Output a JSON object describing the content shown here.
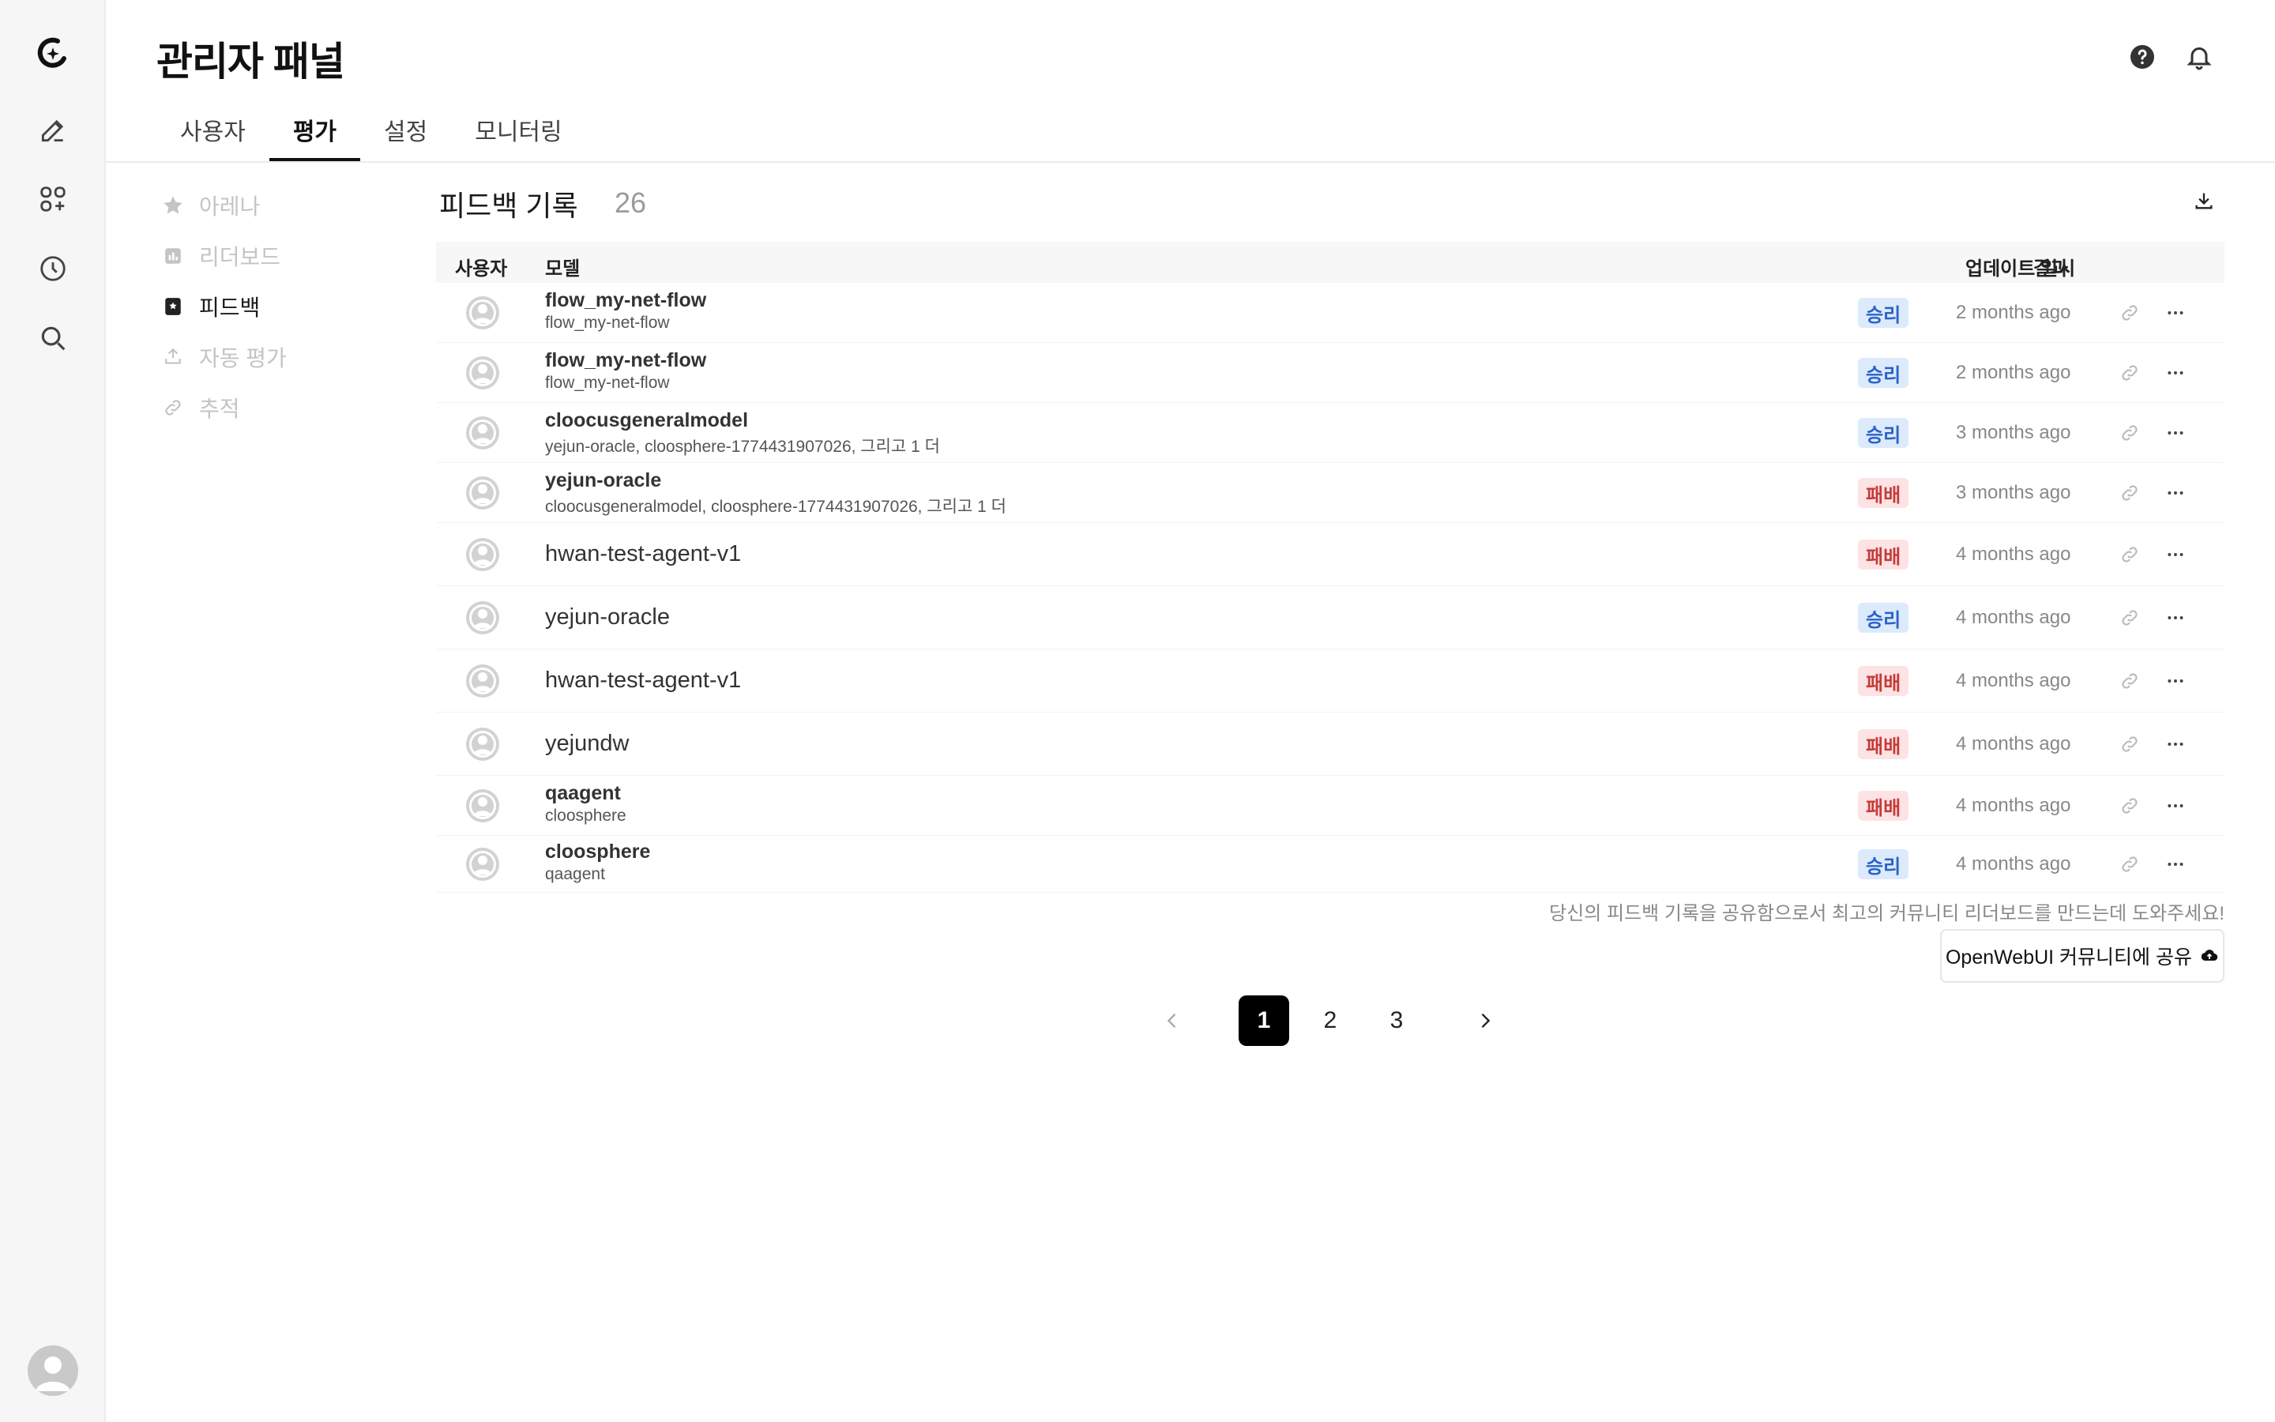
{
  "header": {
    "title": "관리자 패널",
    "tabs": [
      "사용자",
      "평가",
      "설정",
      "모니터링"
    ],
    "active_tab": "평가"
  },
  "rail": {
    "icons": [
      "logo-icon",
      "edit-icon",
      "apps-icon",
      "history-icon",
      "search-icon"
    ],
    "avatar": "user-avatar"
  },
  "subnav": {
    "items": [
      {
        "label": "아레나",
        "icon": "star-icon"
      },
      {
        "label": "리더보드",
        "icon": "leaderboard-icon"
      },
      {
        "label": "피드백",
        "icon": "feedback-icon"
      },
      {
        "label": "자동 평가",
        "icon": "auto-eval-icon"
      },
      {
        "label": "추적",
        "icon": "link-icon"
      }
    ],
    "active": "피드백"
  },
  "feedback": {
    "title": "피드백 기록",
    "count": "26",
    "columns": {
      "user": "사용자",
      "model": "모델",
      "result": "결과",
      "updated": "업데이트 일시"
    },
    "rows": [
      {
        "model": "flow_my-net-flow",
        "sub": "flow_my-net-flow",
        "result": "승리",
        "type": "win",
        "time": "2 months ago"
      },
      {
        "model": "flow_my-net-flow",
        "sub": "flow_my-net-flow",
        "result": "승리",
        "type": "win",
        "time": "2 months ago"
      },
      {
        "model": "cloocusgeneralmodel",
        "sub": "yejun-oracle, cloosphere-1774431907026, 그리고 1 더",
        "result": "승리",
        "type": "win",
        "time": "3 months ago"
      },
      {
        "model": "yejun-oracle",
        "sub": "cloocusgeneralmodel, cloosphere-1774431907026, 그리고 1 더",
        "result": "패배",
        "type": "lose",
        "time": "3 months ago"
      },
      {
        "model": "hwan-test-agent-v1",
        "sub": "",
        "result": "패배",
        "type": "lose",
        "time": "4 months ago"
      },
      {
        "model": "yejun-oracle",
        "sub": "",
        "result": "승리",
        "type": "win",
        "time": "4 months ago"
      },
      {
        "model": "hwan-test-agent-v1",
        "sub": "",
        "result": "패배",
        "type": "lose",
        "time": "4 months ago"
      },
      {
        "model": "yejundw",
        "sub": "",
        "result": "패배",
        "type": "lose",
        "time": "4 months ago"
      },
      {
        "model": "qaagent",
        "sub": "cloosphere",
        "result": "패배",
        "type": "lose",
        "time": "4 months ago"
      },
      {
        "model": "cloosphere",
        "sub": "qaagent",
        "result": "승리",
        "type": "win",
        "time": "4 months ago"
      }
    ],
    "share_note": "당신의 피드백 기록을 공유함으로서 최고의 커뮤니티 리더보드를 만드는데 도와주세요!",
    "share_button": "OpenWebUI 커뮤니티에 공유"
  },
  "pagination": {
    "pages": [
      "1",
      "2",
      "3"
    ],
    "current": "1"
  }
}
